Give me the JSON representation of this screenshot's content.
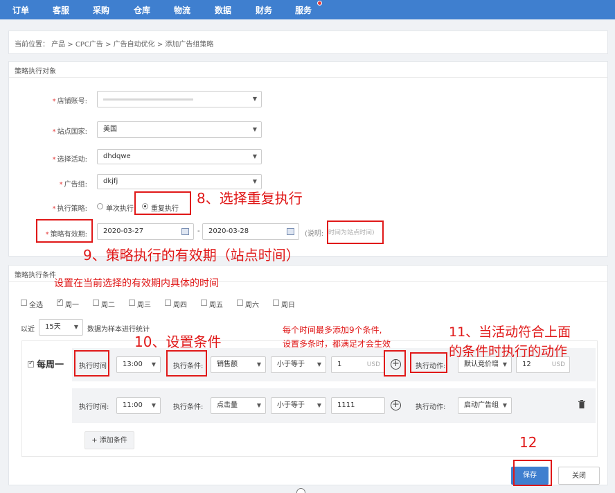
{
  "nav": {
    "items": [
      "订单",
      "客服",
      "采购",
      "仓库",
      "物流",
      "数据",
      "财务",
      "服务"
    ]
  },
  "breadcrumb": "当前位置：  产品 > CPC广告 > 广告自动优化 > 添加广告组策略",
  "target_panel": {
    "title": "策略执行对象",
    "shop": {
      "label": "店铺账号:",
      "value": ""
    },
    "site": {
      "label": "站点国家:",
      "value": "美国"
    },
    "campaign": {
      "label": "选择活动:",
      "value": "dhdqwe"
    },
    "adgroup": {
      "label": "广告组:",
      "value": "dkjfj"
    },
    "strategy": {
      "label": "执行策略:",
      "options": [
        "单次执行",
        "重复执行"
      ],
      "selected": 1
    },
    "validity": {
      "label": "策略有效期:",
      "start": "2020-03-27",
      "end": "2020-03-28",
      "sep": "-",
      "note_prefix": "(说明:",
      "note": "时间为站点时间)"
    }
  },
  "cond_panel": {
    "title": "策略执行条件",
    "weekdays": [
      {
        "label": "全选",
        "checked": false
      },
      {
        "label": "周一",
        "checked": true
      },
      {
        "label": "周二",
        "checked": false
      },
      {
        "label": "周三",
        "checked": false
      },
      {
        "label": "周四",
        "checked": false
      },
      {
        "label": "周五",
        "checked": false
      },
      {
        "label": "周六",
        "checked": false
      },
      {
        "label": "周日",
        "checked": false
      }
    ],
    "period_prefix": "以近",
    "period_value": "15天",
    "period_suffix": "数据为样本进行统计",
    "day_label": "每周一",
    "rows": [
      {
        "time_label": "执行时间",
        "time": "13:00",
        "cond_label": "执行条件:",
        "metric": "销售额",
        "op": "小于等于",
        "value": "1",
        "unit": "USD",
        "action_label": "执行动作:",
        "action": "默认竞价增",
        "action_value": "12",
        "action_unit": "USD"
      },
      {
        "time_label": "执行时间:",
        "time": "11:00",
        "cond_label": "执行条件:",
        "metric": "点击量",
        "op": "小于等于",
        "value": "1111",
        "unit": "",
        "action_label": "执行动作:",
        "action": "启动广告组",
        "action_value": "",
        "action_unit": ""
      }
    ],
    "add_label": "+ 添加条件"
  },
  "buttons": {
    "save": "保存",
    "close": "关闭"
  },
  "annotations": {
    "a8": "8、选择重复执行",
    "a9": "9、策略执行的有效期（站点时间）",
    "a9sub": "设置在当前选择的有效期内具体的时间",
    "a10": "10、设置条件",
    "limit1": "每个时间最多添加9个条件,",
    "limit2": "设置多条时，都满足才会生效",
    "a11a": "11、当活动符合上面",
    "a11b": "的条件时执行的动作",
    "a12": "12"
  }
}
